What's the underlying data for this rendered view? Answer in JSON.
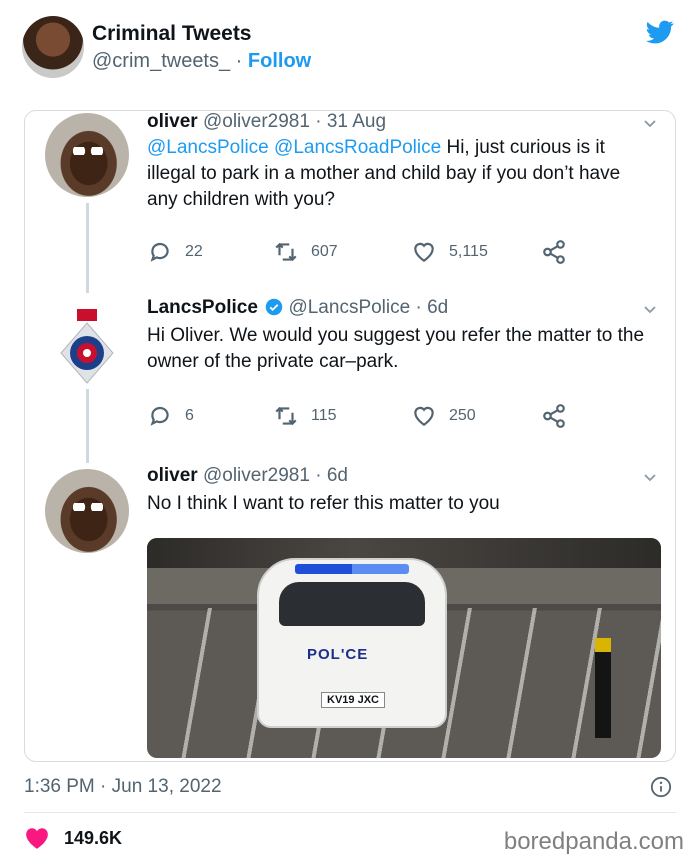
{
  "header": {
    "account_name": "Criminal Tweets",
    "handle": "@crim_tweets_",
    "separator": " · ",
    "follow_label": "Follow",
    "brand_icon": "twitter-bird-icon"
  },
  "tweets": [
    {
      "name": "oliver",
      "handle": "@oliver2981",
      "date": "· 31 Aug",
      "mention1": "@LancsPolice",
      "mention2": "@LancsRoadPolice",
      "text": "Hi, just curious is it illegal to park in a mother and child bay if you don’t have any children with you?",
      "replies": "22",
      "retweets": "607",
      "likes": "5,115"
    },
    {
      "name": "LancsPolice",
      "handle": "@LancsPolice",
      "date": "· 6d",
      "verified": true,
      "text": "Hi Oliver. We would you suggest you refer the matter to the owner of the private car–park.",
      "replies": "6",
      "retweets": "115",
      "likes": "250"
    },
    {
      "name": "oliver",
      "handle": "@oliver2981",
      "date": "· 6d",
      "text": "No I think I want to refer this matter to you",
      "photo_text_police": "POL'CE",
      "photo_text_plate": "KV19 JXC"
    }
  ],
  "footer": {
    "timestamp": "1:36 PM · Jun 13, 2022",
    "like_count": "149.6K",
    "watermark": "boredpanda.com"
  },
  "colors": {
    "accent": "#1d9bf0",
    "like": "#f91880",
    "muted": "#536471"
  }
}
